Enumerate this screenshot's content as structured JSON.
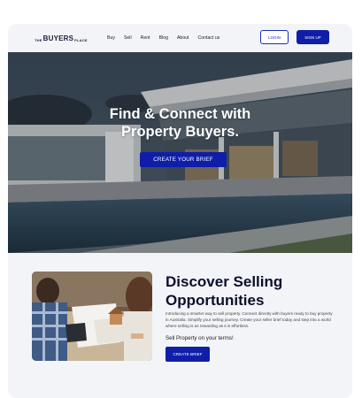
{
  "logo": {
    "the": "THE",
    "buyers": "BUYERS",
    "place": "PLACE"
  },
  "nav": {
    "items": [
      "Buy",
      "Sell",
      "Rent",
      "Blog",
      "About",
      "Contact us"
    ]
  },
  "header": {
    "login_label": "LOGIN",
    "signup_label": "SIGN UP"
  },
  "hero": {
    "title_line1": "Find & Connect with",
    "title_line2": "Property Buyers.",
    "cta_label": "CREATE YOUR BRIEF"
  },
  "discover": {
    "title_line1": "Discover Selling",
    "title_line2": "Opportunities",
    "body": "Introducing a smarter way to sell property. Connect directly with buyers ready to buy property in Australia. Simplify your selling journey. Create your seller brief today and step into a world where selling is as rewarding as it is effortless.",
    "subheading": "Sell Property on your terms!",
    "cta_label": "CREATE BRIEF"
  },
  "colors": {
    "brand": "#0e1ea8",
    "page_bg": "#f3f4f8",
    "heading": "#0b0f2b"
  }
}
